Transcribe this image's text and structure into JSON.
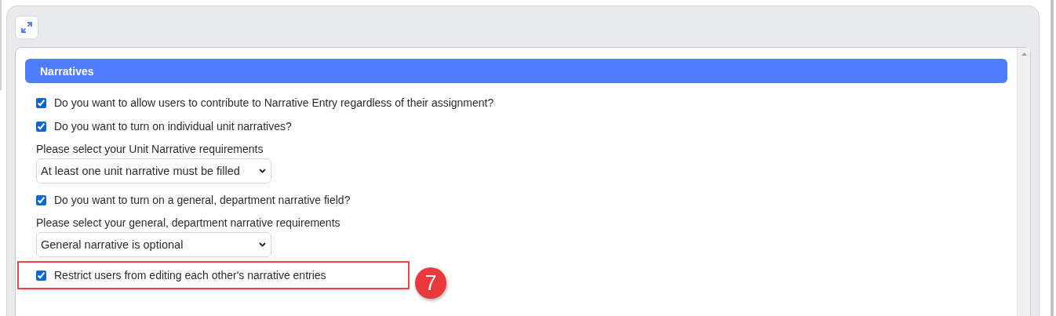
{
  "section": {
    "title": "Narratives"
  },
  "items": [
    {
      "kind": "checkbox",
      "label": "Do you want to allow users to contribute to Narrative Entry regardless of their assignment?",
      "checked": true,
      "highlighted": false
    },
    {
      "kind": "checkbox",
      "label": "Do you want to turn on individual unit narratives?",
      "checked": true,
      "highlighted": false
    },
    {
      "kind": "select",
      "label": "Please select your Unit Narrative requirements",
      "value": "At least one unit narrative must be filled"
    },
    {
      "kind": "checkbox",
      "label": "Do you want to turn on a general, department narrative field?",
      "checked": true,
      "highlighted": false
    },
    {
      "kind": "select",
      "label": "Please select your general, department narrative requirements",
      "value": "General narrative is optional"
    },
    {
      "kind": "checkbox",
      "label": "Restrict users from editing each other's narrative entries",
      "checked": true,
      "highlighted": true,
      "badge": "7"
    }
  ]
}
